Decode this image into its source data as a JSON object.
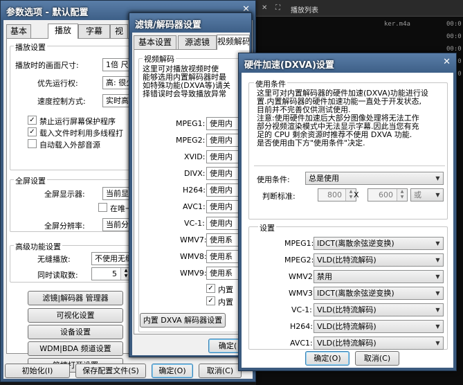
{
  "player": {
    "playlist_title": "播放列表",
    "controls": [
      "✕",
      "⛶",
      "—"
    ],
    "rows": [
      {
        "name": "ker.m4a",
        "time": "00:0"
      },
      {
        "name": "",
        "time": "00:0"
      },
      {
        "name": "",
        "time": "00:0"
      },
      {
        "name": "",
        "time": "00:0"
      },
      {
        "name": "",
        "time": "00:0"
      }
    ]
  },
  "prefs": {
    "title": "参数选项 - 默认配置",
    "close": "✕",
    "tabs": [
      "基本",
      "播放",
      "字幕",
      "视"
    ],
    "playback": {
      "title": "播放设置",
      "size_label": "播放时的画面尺寸:",
      "size_value": "1倍 尺寸",
      "priority_label": "优先运行权:",
      "priority_value": "高: 很少",
      "speed_label": "速度控制方式:",
      "speed_value": "实时高",
      "chk1": "禁止运行屏幕保护程序",
      "chk2": "载入文件时利用多线程打",
      "chk3": "自动载入外部音源"
    },
    "fullscreen": {
      "title": "全屏设置",
      "display_label": "全屏显示器:",
      "display_value": "当前显",
      "chk": "在唯一",
      "res_label": "全屏分辨率:",
      "res_value": "当前分"
    },
    "advanced": {
      "title": "高级功能设置",
      "seamless_label": "无缝播放:",
      "seamless_value": "不使用无缝",
      "read_label": "同时读取数:",
      "read_value": "5"
    },
    "buttons": [
      "滤镜|解码器 管理器",
      "可视化设置",
      "设备设置",
      "WDM|BDA 频道设置",
      "简捷打开设置"
    ],
    "bottom": {
      "init": "初始化(I)",
      "save": "保存配置文件(S)",
      "ok": "确定(O)",
      "cancel": "取消(C)"
    }
  },
  "filters": {
    "title": "滤镜/解码器设置",
    "close": "✕",
    "tabs": [
      "基本设置",
      "源滤镜",
      "视频解码",
      "音频解码",
      "滤镜优先权"
    ],
    "group_title": "视频解码",
    "desc": [
      "这里可对播放视频时使",
      "能够选用内置解码器时最",
      "如特殊功能(DXVA等)请关",
      "择错误时会导致播放异常"
    ],
    "codecs": [
      {
        "label": "MPEG1:",
        "value": "使用内"
      },
      {
        "label": "MPEG2:",
        "value": "使用内"
      },
      {
        "label": "XVID:",
        "value": "使用内"
      },
      {
        "label": "DIVX:",
        "value": "使用内"
      },
      {
        "label": "H264:",
        "value": "使用内"
      },
      {
        "label": "AVC1:",
        "value": "使用内"
      },
      {
        "label": "VC-1:",
        "value": "使用内"
      },
      {
        "label": "WMV7:",
        "value": "使用系"
      },
      {
        "label": "WMV8:",
        "value": "使用系"
      },
      {
        "label": "WMV9:",
        "value": "使用系"
      }
    ],
    "chk1": "内置",
    "chk2": "内置",
    "dxva_button": "内置 DXVA 解码器设置",
    "ok": "确定("
  },
  "dxva": {
    "title": "硬件加速(DXVA)设置",
    "close": "✕",
    "cond_group": "使用条件",
    "desc": [
      "这里可对内置解码器的硬件加速(DXVA)功能进行设",
      "置.内置解码器的硬件加速功能一直处于开发状态,",
      "目前并不完善仅供测试使用.",
      "注意:使用硬件加速后大部分图像处理将无法工作",
      "部分视频渲染模式中无法显示字幕.因此当您有充",
      "足的 CPU 剩余资源时推荐不使用 DXVA 功能.",
      "是否使用由下方\"使用条件\"决定."
    ],
    "cond_label": "使用条件:",
    "cond_value": "总是使用",
    "std_label": "判断标准:",
    "std_w": "800",
    "std_x": "X",
    "std_h": "600",
    "std_op": "或",
    "settings_group": "设置",
    "codecs": [
      {
        "label": "MPEG1:",
        "value": "IDCT(离散余弦逆变换)"
      },
      {
        "label": "MPEG2:",
        "value": "VLD(比特流解码)"
      },
      {
        "label": "WMV2:",
        "value": "禁用"
      },
      {
        "label": "WMV3:",
        "value": "IDCT(离散余弦逆变换)"
      },
      {
        "label": "VC-1:",
        "value": "VLD(比特流解码)"
      },
      {
        "label": "H264:",
        "value": "VLD(比特流解码)"
      },
      {
        "label": "AVC1:",
        "value": "VLD(比特流解码)"
      }
    ],
    "ok": "确定(O)",
    "cancel": "取消(C)"
  }
}
